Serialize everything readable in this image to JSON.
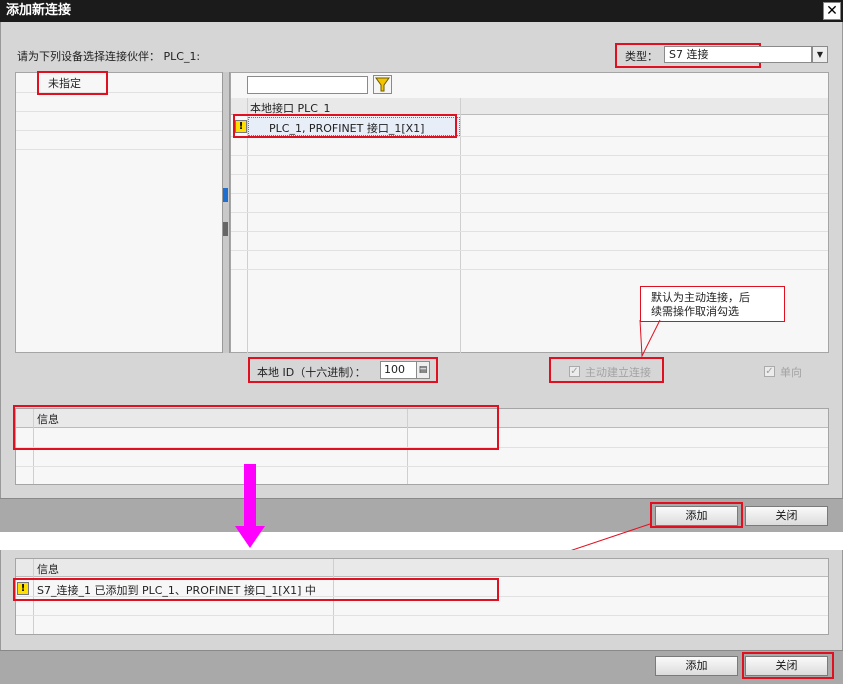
{
  "dialog": {
    "title": "添加新连接",
    "close_glyph": "✕",
    "select_partner_label": "请为下列设备选择连接伙伴： PLC_1:",
    "type_label": "类型：",
    "type_value": "S7 连接",
    "partner_tree": {
      "unspecified": "未指定"
    },
    "interface_table": {
      "header": "本地接口 PLC_1",
      "rows": [
        {
          "text": "PLC_1, PROFINET 接口_1[X1]"
        }
      ]
    },
    "local_id": {
      "label": "本地 ID（十六进制）：",
      "value": "100"
    },
    "active_connection": {
      "label": "主动建立连接",
      "checked": true
    },
    "one_way": {
      "label": "单向",
      "checked": true
    },
    "callout": {
      "line1": "默认为主动连接，后",
      "line2": "续需操作取消勾选"
    },
    "info_table": {
      "header": "信息"
    },
    "buttons": {
      "add": "添加",
      "close": "关闭"
    }
  },
  "result": {
    "info_table": {
      "header": "信息",
      "rows": [
        {
          "text": "S7_连接_1 已添加到 PLC_1、PROFINET 接口_1[X1] 中"
        }
      ]
    },
    "buttons": {
      "add": "添加",
      "close": "关闭"
    }
  },
  "colors": {
    "highlight": "#e01020",
    "arrow": "#ff00ff",
    "warning": "#ffe000",
    "titlebar": "#1b1b1b"
  },
  "icons": {
    "filter": "funnel-icon",
    "warning": "warning-icon",
    "spin": "spinner-icon",
    "dropdown": "chevron-down-icon",
    "close": "close-icon"
  }
}
